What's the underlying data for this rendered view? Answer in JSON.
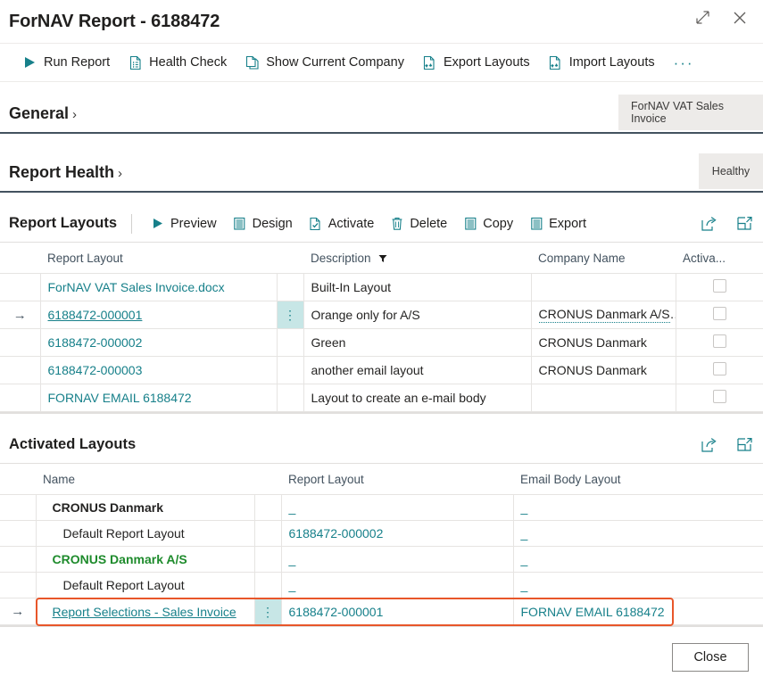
{
  "window": {
    "title": "ForNAV Report - 6188472",
    "expand_icon": "expand-diagonal-icon",
    "close_icon": "close-icon"
  },
  "commandbar": {
    "items": [
      {
        "label": "Run Report",
        "icon": "play-icon"
      },
      {
        "label": "Health Check",
        "icon": "document-check-icon"
      },
      {
        "label": "Show Current Company",
        "icon": "document-copy-icon"
      },
      {
        "label": "Export Layouts",
        "icon": "document-export-icon"
      },
      {
        "label": "Import Layouts",
        "icon": "document-import-icon"
      }
    ],
    "overflow_label": "···"
  },
  "general": {
    "title": "General",
    "chevron": "›",
    "badge": "ForNAV VAT Sales Invoice"
  },
  "report_health": {
    "title": "Report Health",
    "chevron": "›",
    "badge": "Healthy"
  },
  "report_layouts": {
    "title": "Report Layouts",
    "actions": [
      {
        "label": "Preview",
        "icon": "play-icon"
      },
      {
        "label": "Design",
        "icon": "design-document-icon"
      },
      {
        "label": "Activate",
        "icon": "document-check-icon"
      },
      {
        "label": "Delete",
        "icon": "trash-icon"
      },
      {
        "label": "Copy",
        "icon": "copy-document-icon"
      },
      {
        "label": "Export",
        "icon": "export-document-icon"
      }
    ],
    "right_icons": [
      {
        "name": "share-icon"
      },
      {
        "name": "open-in-new-window-icon"
      }
    ],
    "columns": [
      "Report Layout",
      "Description",
      "Company Name",
      "Activa..."
    ],
    "description_filter_icon": "filter-icon",
    "rows": [
      {
        "selected": false,
        "arrow": "",
        "layout": "ForNAV VAT Sales Invoice.docx",
        "layout_style": "link",
        "dots": false,
        "description": "Built-In Layout",
        "company": "",
        "company_style": "plain",
        "activated": false
      },
      {
        "selected": true,
        "arrow": "→",
        "layout": "6188472-000001",
        "layout_style": "link-underline",
        "dots": true,
        "description": "Orange only for A/S",
        "company": "CRONUS Danmark A/S",
        "company_style": "dotted",
        "activated": false
      },
      {
        "selected": false,
        "arrow": "",
        "layout": "6188472-000002",
        "layout_style": "link",
        "dots": false,
        "description": "Green",
        "company": "CRONUS Danmark",
        "company_style": "plain",
        "activated": false
      },
      {
        "selected": false,
        "arrow": "",
        "layout": "6188472-000003",
        "layout_style": "link",
        "dots": false,
        "description": "another email layout",
        "company": "CRONUS Danmark",
        "company_style": "plain",
        "activated": false
      },
      {
        "selected": false,
        "arrow": "",
        "layout": "FORNAV EMAIL 6188472",
        "layout_style": "link",
        "dots": false,
        "description": "Layout to create an e-mail body",
        "company": "",
        "company_style": "plain",
        "activated": false
      }
    ]
  },
  "activated_layouts": {
    "title": "Activated Layouts",
    "right_icons": [
      {
        "name": "share-icon"
      },
      {
        "name": "open-in-new-window-icon"
      }
    ],
    "columns": [
      "Name",
      "Report Layout",
      "Email Body Layout"
    ],
    "rows": [
      {
        "arrow": "",
        "name": "CRONUS Danmark",
        "name_style": "bold",
        "indent": 0,
        "dots": false,
        "report_layout": "_",
        "report_layout_style": "dash",
        "email_body_layout": "_",
        "email_body_layout_style": "dash",
        "highlighted": false
      },
      {
        "arrow": "",
        "name": "Default Report Layout",
        "name_style": "plain",
        "indent": 1,
        "dots": false,
        "report_layout": "6188472-000002",
        "report_layout_style": "link",
        "email_body_layout": "_",
        "email_body_layout_style": "dash",
        "highlighted": false
      },
      {
        "arrow": "",
        "name": "CRONUS Danmark A/S",
        "name_style": "green-bold",
        "indent": 0,
        "dots": false,
        "report_layout": "_",
        "report_layout_style": "dash",
        "email_body_layout": "_",
        "email_body_layout_style": "dash",
        "highlighted": false
      },
      {
        "arrow": "",
        "name": "Default Report Layout",
        "name_style": "plain",
        "indent": 1,
        "dots": false,
        "report_layout": "_",
        "report_layout_style": "dash",
        "email_body_layout": "_",
        "email_body_layout_style": "dash",
        "highlighted": false
      },
      {
        "arrow": "→",
        "name": "Report Selections - Sales Invoice",
        "name_style": "link-underline",
        "indent": 0,
        "dots": true,
        "report_layout": "6188472-000001",
        "report_layout_style": "link",
        "email_body_layout": "FORNAV EMAIL 6188472",
        "email_body_layout_style": "link",
        "highlighted": true
      }
    ]
  },
  "footer": {
    "close_label": "Close"
  },
  "colors": {
    "accent": "#17808a",
    "highlight_border": "#e8562a",
    "selected_cell": "#c7e6e6",
    "green_company": "#1e8b2c",
    "section_rule": "#43525f"
  }
}
